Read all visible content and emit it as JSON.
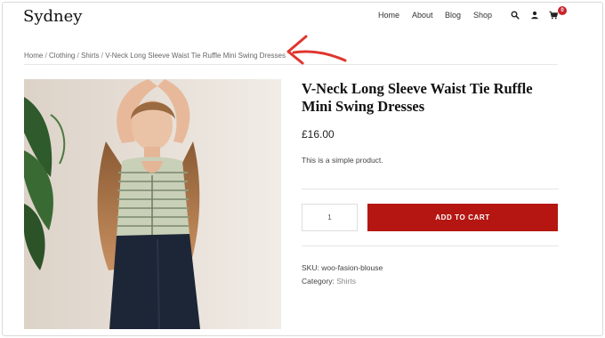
{
  "site": {
    "logo": "Sydney"
  },
  "nav": {
    "home": "Home",
    "about": "About",
    "blog": "Blog",
    "shop": "Shop"
  },
  "header_icons": {
    "search": "search-icon",
    "account": "user-icon",
    "cart": "cart-icon",
    "cart_count": "0"
  },
  "breadcrumb": {
    "items": [
      "Home",
      "Clothing",
      "Shirts",
      "V-Neck Long Sleeve Waist Tie Ruffle Mini Swing Dresses"
    ],
    "separator": "/"
  },
  "product": {
    "title": "V-Neck Long Sleeve Waist Tie Ruffle Mini Swing Dresses",
    "price": "£16.00",
    "description": "This is a simple product.",
    "quantity": "1",
    "add_to_cart": "ADD TO CART",
    "sku_label": "SKU:",
    "sku_value": "woo-fasion-blouse",
    "category_label": "Category:",
    "category_value": "Shirts"
  },
  "colors": {
    "accent": "#b51612",
    "badge": "#c8242a",
    "arrow": "#e0352f"
  }
}
